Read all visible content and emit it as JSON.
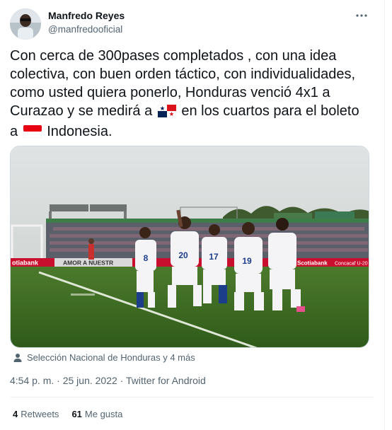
{
  "author": {
    "name": "Manfredo Reyes",
    "handle": "@manfredooficial"
  },
  "tweet": {
    "text_part1": "Con cerca de 300pases completados , con una idea colectiva, con buen orden táctico, con individualidades, como usted quiera ponerlo, Honduras venció 4x1 a Curazao y se medirá a ",
    "flag1": "panama-flag",
    "text_part2": " en los cuartos para el boleto a ",
    "flag2": "indonesia-flag",
    "text_part3": " Indonesia."
  },
  "media": {
    "banner_left": "otiabank",
    "banner_mid": "AMOR A NUESTR",
    "banner_right1": "Scotiabank",
    "banner_right2": "Concacaf U-20",
    "players": [
      "8",
      "20",
      "17",
      "19",
      ""
    ]
  },
  "tagline": "Selección Nacional de Honduras y 4 más",
  "meta": {
    "time": "4:54 p. m.",
    "sep1": " · ",
    "date": "25 jun. 2022",
    "sep2": " · ",
    "source": "Twitter for Android"
  },
  "stats": {
    "retweets_count": "4",
    "retweets_label": "Retweets",
    "likes_count": "61",
    "likes_label": "Me gusta"
  },
  "colors": {
    "text": "#0f1419",
    "secondary": "#536471",
    "border": "#eff3f4"
  }
}
